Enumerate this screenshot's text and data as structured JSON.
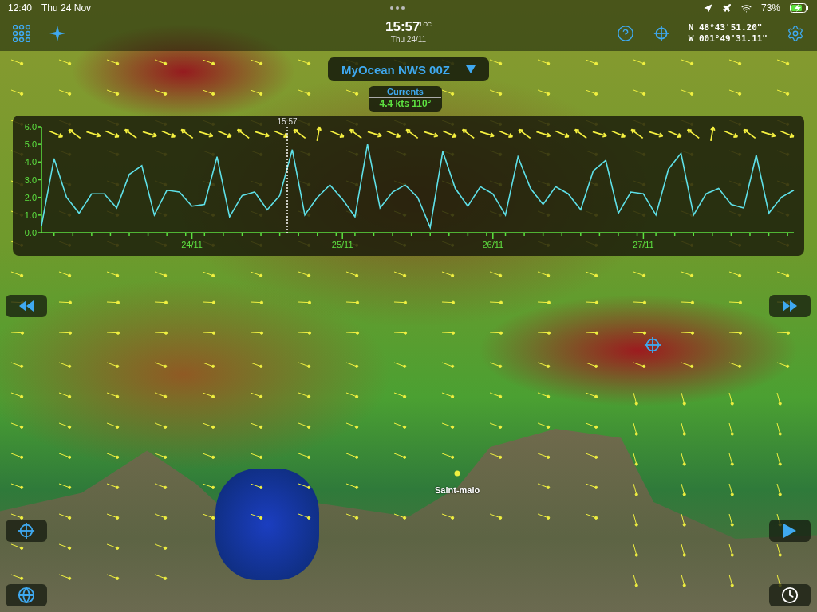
{
  "status_bar": {
    "time": "12:40",
    "date": "Thu 24 Nov",
    "battery": "73%"
  },
  "toolbar": {
    "time": "15:57",
    "time_suffix": "LOC",
    "date": "Thu 24/11",
    "latitude": "N  48°43'51.20\"",
    "longitude": "W 001°49'31.11\""
  },
  "model_selector": {
    "label": "MyOcean NWS 00Z"
  },
  "readout": {
    "title": "Currents",
    "value": "4.4 kts 110°"
  },
  "chart": {
    "cursor_label": "15:57",
    "chart_data": {
      "type": "line",
      "ylim": [
        0,
        6
      ],
      "yticks": [
        {
          "value": 0,
          "label": "0.0"
        },
        {
          "value": 1,
          "label": "1.0"
        },
        {
          "value": 2,
          "label": "2.0"
        },
        {
          "value": 3,
          "label": "3.0"
        },
        {
          "value": 4,
          "label": "4.0"
        },
        {
          "value": 5,
          "label": "5.0"
        },
        {
          "value": 6,
          "label": "6.0"
        }
      ],
      "categories": [
        null,
        null,
        null,
        null,
        null,
        null,
        null,
        null,
        null,
        null,
        null,
        null,
        "24/11",
        null,
        null,
        null,
        null,
        null,
        null,
        null,
        null,
        null,
        null,
        null,
        "25/11",
        null,
        null,
        null,
        null,
        null,
        null,
        null,
        null,
        null,
        null,
        null,
        "26/11",
        null,
        null,
        null,
        null,
        null,
        null,
        null,
        null,
        null,
        null,
        null,
        "27/11",
        null,
        null,
        null,
        null,
        null,
        null,
        null,
        null,
        null,
        null,
        null,
        null
      ],
      "series": [
        {
          "color": "#5ee0e8",
          "values": [
            0.4,
            4.2,
            2.0,
            1.1,
            2.2,
            2.2,
            1.4,
            3.3,
            3.8,
            1.0,
            2.4,
            2.3,
            1.5,
            1.6,
            4.3,
            0.9,
            2.1,
            2.3,
            1.3,
            2.1,
            4.7,
            1.0,
            2.0,
            2.7,
            1.9,
            0.9,
            5.0,
            1.4,
            2.3,
            2.7,
            2.0,
            0.3,
            4.6,
            2.5,
            1.5,
            2.6,
            2.2,
            1.0,
            4.3,
            2.5,
            1.6,
            2.6,
            2.2,
            1.3,
            3.5,
            4.1,
            1.1,
            2.3,
            2.2,
            1.0,
            3.6,
            4.5,
            1.0,
            2.2,
            2.5,
            1.6,
            1.4,
            4.4,
            1.1,
            2.0,
            2.4
          ]
        }
      ]
    }
  },
  "map": {
    "place_label": "Saint-malo"
  }
}
